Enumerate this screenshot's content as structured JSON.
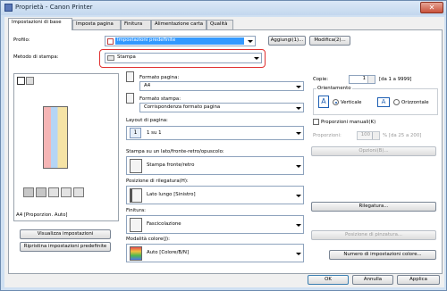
{
  "window": {
    "title": "Proprietà - Canon Printer"
  },
  "tabs": [
    {
      "label": "Impostazioni di base"
    },
    {
      "label": "Imposta pagina"
    },
    {
      "label": "Finitura"
    },
    {
      "label": "Alimentazione carta"
    },
    {
      "label": "Qualità"
    }
  ],
  "profile": {
    "label": "Profilo:",
    "value": "Impostazioni predefinite",
    "add_button": "Aggiungi(1)...",
    "modify_button": "Modifica(2)..."
  },
  "output_method": {
    "label": "Metodo di stampa:",
    "value": "Stampa",
    "highlight_color": "#e03030"
  },
  "preview": {
    "caption": "A4 [Proporzion. Auto]",
    "view_settings_button": "Visualizza impostazioni",
    "restore_defaults_button": "Ripristina impostazioni predefinite"
  },
  "page_size": {
    "label": "Formato pagina:",
    "value": "A4"
  },
  "output_size": {
    "label": "Formato stampa:",
    "value": "Corrispondenza formato pagina"
  },
  "copies": {
    "label": "Copie:",
    "value": "1",
    "range": "[da 1 a 9999]"
  },
  "orientation": {
    "label": "Orientamento",
    "portrait": "Verticale",
    "landscape": "Orizzontale",
    "selected": "portrait"
  },
  "page_layout": {
    "label": "Layout di pagina:",
    "value": "1 su 1"
  },
  "manual_scaling": {
    "label": "Proporzioni manuali(K)",
    "checked": false,
    "scaling_label": "Proporzioni:",
    "scaling_value": "100",
    "scaling_range": "% [da 25 a 200]",
    "options_button": "Opzioni(B)..."
  },
  "print_style": {
    "label": "Stampa su un lato/fronte-retro/opuscolo:",
    "value": "Stampa fronte/retro"
  },
  "binding_location": {
    "label": "Posizione di rilegatura(H):",
    "value": "Lato lungo [Sinistro]",
    "binding_button": "Rilegatura..."
  },
  "finishing": {
    "label": "Finitura:",
    "value": "Fascicolazione",
    "staple_button": "Posizione di pinzatura..."
  },
  "color_mode": {
    "label": "Modalità colore(J):",
    "value": "Auto [Colore/B/N]",
    "color_settings_button": "Numero di impostazioni colore..."
  },
  "footer": {
    "ok": "OK",
    "cancel": "Annulla",
    "apply": "Applica",
    "help": "?"
  }
}
